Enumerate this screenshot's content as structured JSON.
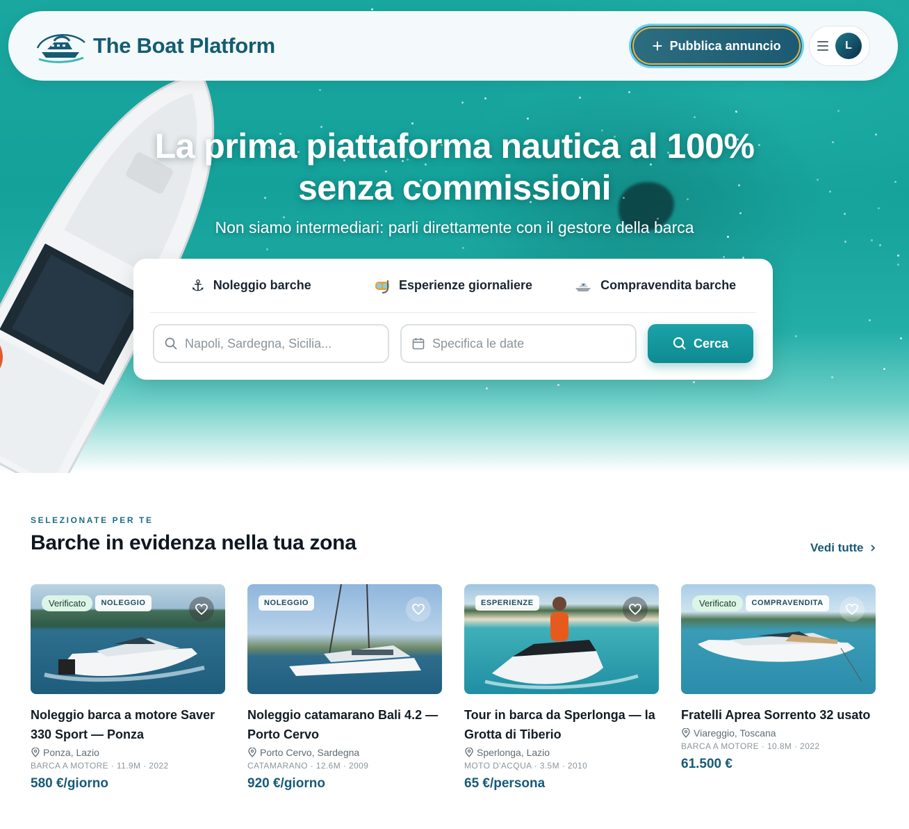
{
  "brand": {
    "name": "The Boat Platform",
    "color": "#145c72"
  },
  "nav": {
    "publish_label": "Pubblica annuncio",
    "avatar_initial": "L"
  },
  "hero": {
    "title_line1": "La prima piattaforma nautica al 100%",
    "title_line2": "senza commissioni",
    "subtitle": "Non siamo intermediari: parli direttamente con il gestore della barca"
  },
  "search": {
    "tabs": [
      {
        "label": "Noleggio barche",
        "icon": "anchor-icon"
      },
      {
        "label": "Esperienze giornaliere",
        "icon": "diving-mask-icon"
      },
      {
        "label": "Compravendita barche",
        "icon": "yacht-icon"
      }
    ],
    "location_placeholder": "Napoli, Sardegna, Sicilia...",
    "dates_placeholder": "Specifica le date",
    "button_label": "Cerca"
  },
  "featured": {
    "eyebrow": "SELEZIONATE PER TE",
    "title": "Barche in evidenza nella tua zona",
    "see_all": "Vedi tutte",
    "cards": [
      {
        "verified": "Verificato",
        "category": "NOLEGGIO",
        "title": "Noleggio barca a motore Saver 330 Sport — Ponza",
        "location": "Ponza, Lazio",
        "meta": "BARCA A MOTORE · 11.9M · 2022",
        "price": "580 €/giorno"
      },
      {
        "verified": "",
        "category": "NOLEGGIO",
        "title": "Noleggio catamarano Bali 4.2 — Porto Cervo",
        "location": "Porto Cervo, Sardegna",
        "meta": "CATAMARANO · 12.6M · 2009",
        "price": "920 €/giorno"
      },
      {
        "verified": "",
        "category": "ESPERIENZE",
        "title": "Tour in barca da Sperlonga — la Grotta di Tiberio",
        "location": "Sperlonga, Lazio",
        "meta": "MOTO D'ACQUA · 3.5M · 2010",
        "price": "65 €/persona"
      },
      {
        "verified": "Verificato",
        "category": "COMPRAVENDITA",
        "title": "Fratelli Aprea Sorrento 32 usato",
        "location": "Viareggio, Toscana",
        "meta": "BARCA A MOTORE · 10.8M · 2022",
        "price": "61.500 €"
      }
    ]
  },
  "colors": {
    "accent": "#175a78",
    "teal": "#1aa3a8",
    "verified_bg": "#dcf5e6"
  }
}
